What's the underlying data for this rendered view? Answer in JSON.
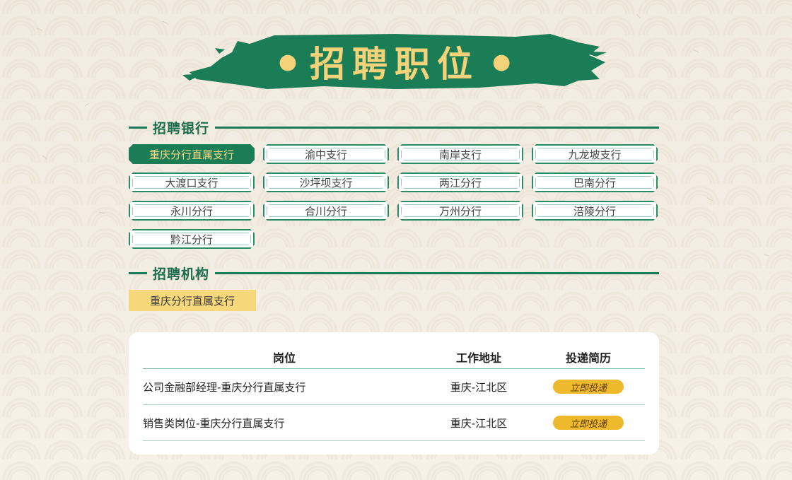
{
  "page_title": "招聘职位",
  "sections": {
    "banks": {
      "title": "招聘银行"
    },
    "orgs": {
      "title": "招聘机构"
    }
  },
  "branches": [
    {
      "label": "重庆分行直属支行",
      "active": true
    },
    {
      "label": "渝中支行",
      "active": false
    },
    {
      "label": "南岸支行",
      "active": false
    },
    {
      "label": "九龙坡支行",
      "active": false
    },
    {
      "label": "大渡口支行",
      "active": false
    },
    {
      "label": "沙坪坝支行",
      "active": false
    },
    {
      "label": "两江分行",
      "active": false
    },
    {
      "label": "巴南分行",
      "active": false
    },
    {
      "label": "永川分行",
      "active": false
    },
    {
      "label": "合川分行",
      "active": false
    },
    {
      "label": "万州分行",
      "active": false
    },
    {
      "label": "涪陵分行",
      "active": false
    },
    {
      "label": "黔江分行",
      "active": false
    }
  ],
  "org_selected": "重庆分行直属支行",
  "table": {
    "headers": {
      "position": "岗位",
      "location": "工作地址",
      "apply": "投递简历"
    },
    "rows": [
      {
        "position": "公司金融部经理-重庆分行直属支行",
        "location": "重庆-江北区",
        "action": "立即投递"
      },
      {
        "position": "销售类岗位-重庆分行直属支行",
        "location": "重庆-江北区",
        "action": "立即投递"
      }
    ]
  },
  "colors": {
    "brand_green": "#1b7d55",
    "gold_text": "#f4d27a",
    "chip_yellow": "#f6d779",
    "apply_button": "#efb92d"
  }
}
